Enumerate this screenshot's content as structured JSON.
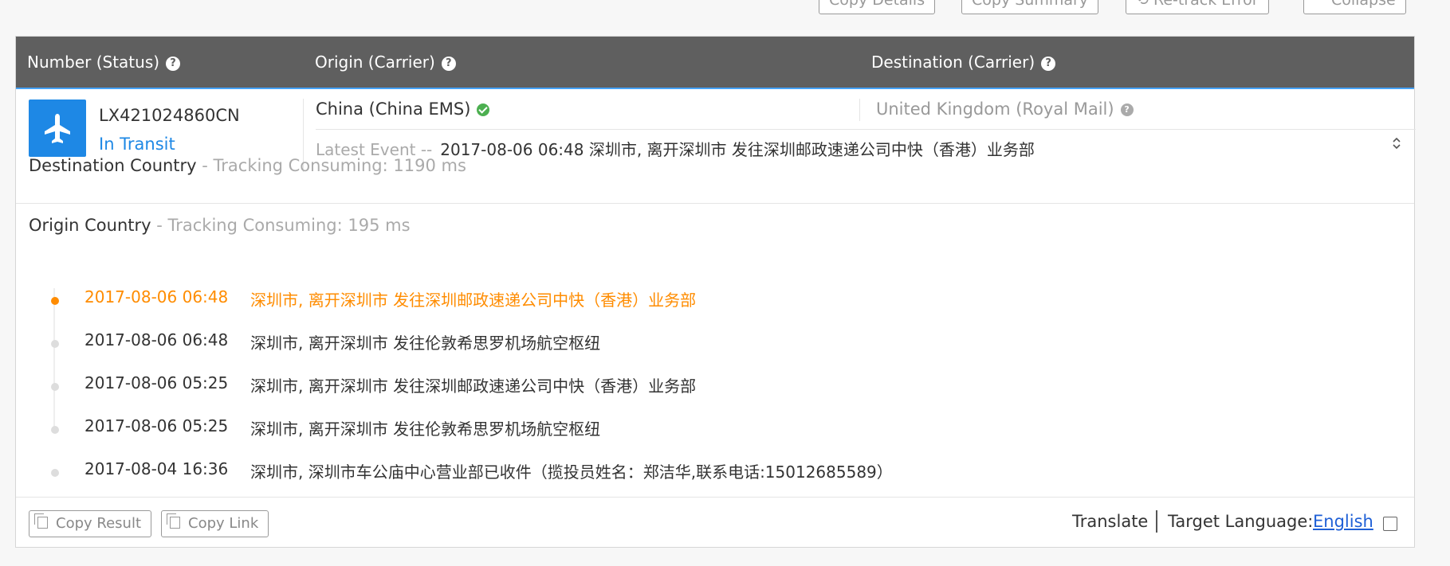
{
  "toolbar": {
    "copy_details": "Copy Details",
    "copy_summary": "Copy Summary",
    "retrack_error": "Re-track Error",
    "collapse": "Collapse"
  },
  "table_header": {
    "number_status": "Number (Status)",
    "origin_carrier": "Origin (Carrier)",
    "destination_carrier": "Destination (Carrier)",
    "help_glyph": "?"
  },
  "shipment": {
    "icon": "plane-icon",
    "tracking_number": "LX421024860CN",
    "status": "In Transit",
    "origin": "China (China EMS)",
    "destination": "United Kingdom (Royal Mail)",
    "latest_event_label": "Latest Event --",
    "latest_event_value": "2017-08-06 06:48 深圳市, 离开深圳市 发往深圳邮政速递公司中快（香港）业务部"
  },
  "destination_country": {
    "title": "Destination Country",
    "timing": " - Tracking Consuming: 1190 ms"
  },
  "origin_country": {
    "title": "Origin Country",
    "timing": " - Tracking Consuming: 195 ms",
    "events": [
      {
        "time": "2017-08-06 06:48",
        "desc": "深圳市, 离开深圳市 发往深圳邮政速递公司中快（香港）业务部"
      },
      {
        "time": "2017-08-06 06:48",
        "desc": "深圳市, 离开深圳市 发往伦敦希思罗机场航空枢纽"
      },
      {
        "time": "2017-08-06 05:25",
        "desc": "深圳市, 离开深圳市 发往深圳邮政速递公司中快（香港）业务部"
      },
      {
        "time": "2017-08-06 05:25",
        "desc": "深圳市, 离开深圳市 发往伦敦希思罗机场航空枢纽"
      },
      {
        "time": "2017-08-04 16:36",
        "desc": "深圳市, 深圳市车公庙中心营业部已收件（揽投员姓名：郑洁华,联系电话:15012685589）"
      }
    ]
  },
  "footer": {
    "copy_result": "Copy Result",
    "copy_link": "Copy Link",
    "translate": "Translate",
    "target_language_label": "Target Language:",
    "target_language": "English"
  },
  "colors": {
    "header_bg": "#5f5f5f",
    "accent_blue": "#1e88e5",
    "active_orange": "#ff8c00",
    "check_green": "#4caf50"
  }
}
